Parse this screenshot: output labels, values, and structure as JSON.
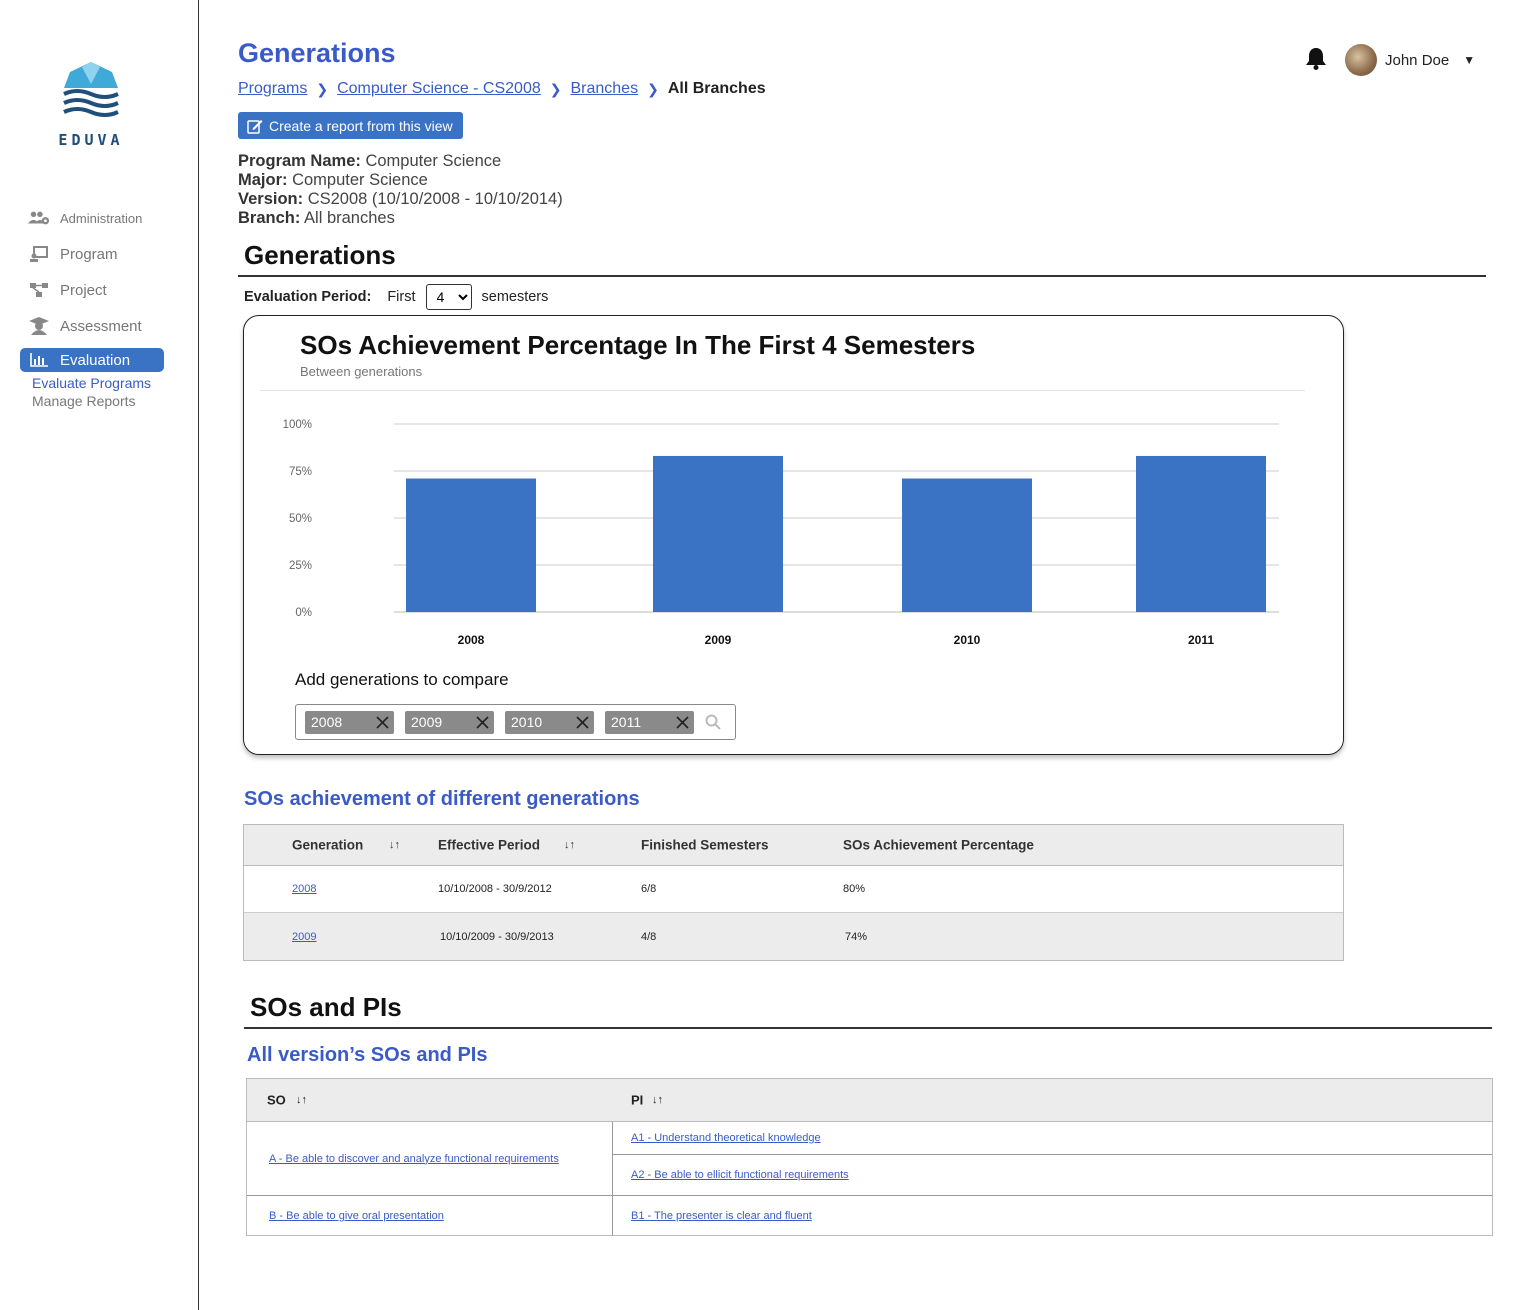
{
  "brand": {
    "name": "EDUVA"
  },
  "sidebar": {
    "items": [
      {
        "label": "Administration",
        "icon": "users-gear-icon"
      },
      {
        "label": "Program",
        "icon": "program-icon"
      },
      {
        "label": "Project",
        "icon": "project-icon"
      },
      {
        "label": "Assessment",
        "icon": "graduate-icon"
      },
      {
        "label": "Evaluation",
        "icon": "bar-chart-icon",
        "active": true
      }
    ],
    "subitems": [
      {
        "label": "Evaluate Programs",
        "active": true
      },
      {
        "label": "Manage Reports",
        "active": false
      }
    ]
  },
  "header": {
    "title": "Generations",
    "breadcrumb": [
      "Programs",
      "Computer Science - CS2008",
      "Branches",
      "All Branches"
    ],
    "report_button": "Create a report from this view",
    "user_name": "John Doe"
  },
  "info": {
    "program_label": "Program Name:",
    "program_value": "Computer Science",
    "major_label": "Major:",
    "major_value": "Computer Science",
    "version_label": "Version:",
    "version_value": "CS2008 (10/10/2008 - 10/10/2014)",
    "branch_label": "Branch:",
    "branch_value": "All branches"
  },
  "generations_section": {
    "heading": "Generations",
    "eval_label": "Evaluation Period:",
    "first_label": "First",
    "semesters_value": "4",
    "semesters_label": "semesters",
    "compare_label": "Add generations to compare",
    "tags": [
      "2008",
      "2009",
      "2010",
      "2011"
    ]
  },
  "chart_data": {
    "type": "bar",
    "title": "SOs Achievement Percentage In The First 4 Semesters",
    "subtitle": "Between generations",
    "categories": [
      "2008",
      "2009",
      "2010",
      "2011"
    ],
    "values": [
      71,
      83,
      71,
      83
    ],
    "ylim": [
      0,
      100
    ],
    "yticks": [
      "0%",
      "25%",
      "50%",
      "75%",
      "100%"
    ],
    "bar_color": "#3a72c4",
    "grid": true
  },
  "so_generations": {
    "heading": "SOs achievement of different generations",
    "columns": [
      "Generation",
      "Effective Period",
      "Finished Semesters",
      "SOs Achievement Percentage"
    ],
    "rows": [
      {
        "generation": "2008",
        "period": "10/10/2008  - 30/9/2012",
        "finished": "6/8",
        "percent": "80%"
      },
      {
        "generation": "2009",
        "period": "10/10/2009 - 30/9/2013",
        "finished": "4/8",
        "percent": "74%"
      }
    ]
  },
  "sos_pis": {
    "heading": "SOs and PIs",
    "subheading": "All version’s SOs and PIs",
    "columns": [
      "SO",
      "PI"
    ],
    "so_a": "A - Be able to discover and analyze functional requirements",
    "pi_a1": "A1 - Understand theoretical knowledge",
    "pi_a2": "A2 - Be able to ellicit functional requirements",
    "so_b": "B - Be able to give oral presentation",
    "pi_b1": "B1 - The presenter is clear and fluent"
  },
  "sort_symbol": "↓↑"
}
